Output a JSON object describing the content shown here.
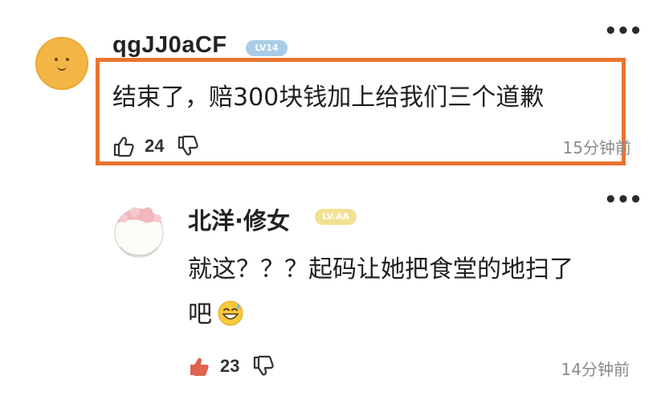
{
  "comments": [
    {
      "username": "qgJJ0aCF",
      "level_badge": "LV14",
      "text": "结束了，赔300块钱加上给我们三个道歉",
      "likes": "24",
      "time": "15分钟前",
      "more": "•••"
    },
    {
      "username": "北洋·修女",
      "level_badge": "LV.AA",
      "text_line1": "就这？？？起码让她把食堂的地扫了",
      "text_line2": "吧",
      "emoji": "grinning-sweat-emoji",
      "likes": "23",
      "time": "14分钟前",
      "more": "•••"
    }
  ],
  "colors": {
    "highlight_border": "#e8742f",
    "avatar1_fill": "#f3b646",
    "badge1": "#a9cde8",
    "badge2": "#f1e192",
    "like_active": "#e0624f",
    "timestamp": "#8a8a8a"
  },
  "icons": {
    "like": "thumbs-up-icon",
    "dislike": "thumbs-down-icon",
    "more": "more-dots-icon"
  }
}
